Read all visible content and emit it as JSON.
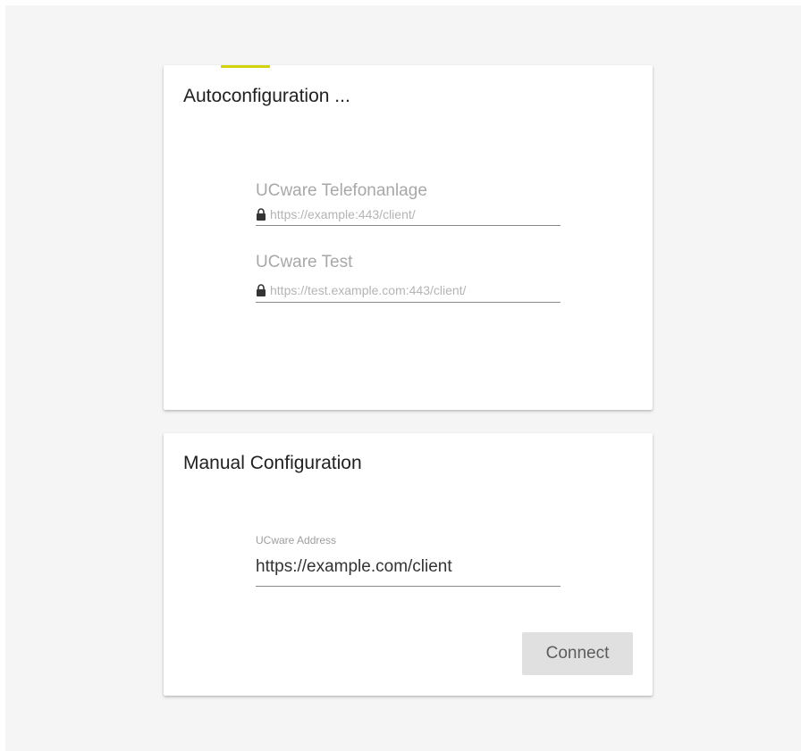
{
  "autoconfig": {
    "title": "Autoconfiguration ...",
    "progress_color": "#d2d20a",
    "servers": [
      {
        "name": "UCware Telefonanlage",
        "url": "https://example:443/client/",
        "icon": "lock-icon"
      },
      {
        "name": "UCware Test",
        "url": "https://test.example.com:443/client/",
        "icon": "lock-icon"
      }
    ]
  },
  "manual": {
    "title": "Manual Configuration",
    "address_label": "UCware Address",
    "address_value": "https://example.com/client",
    "connect_label": "Connect"
  }
}
